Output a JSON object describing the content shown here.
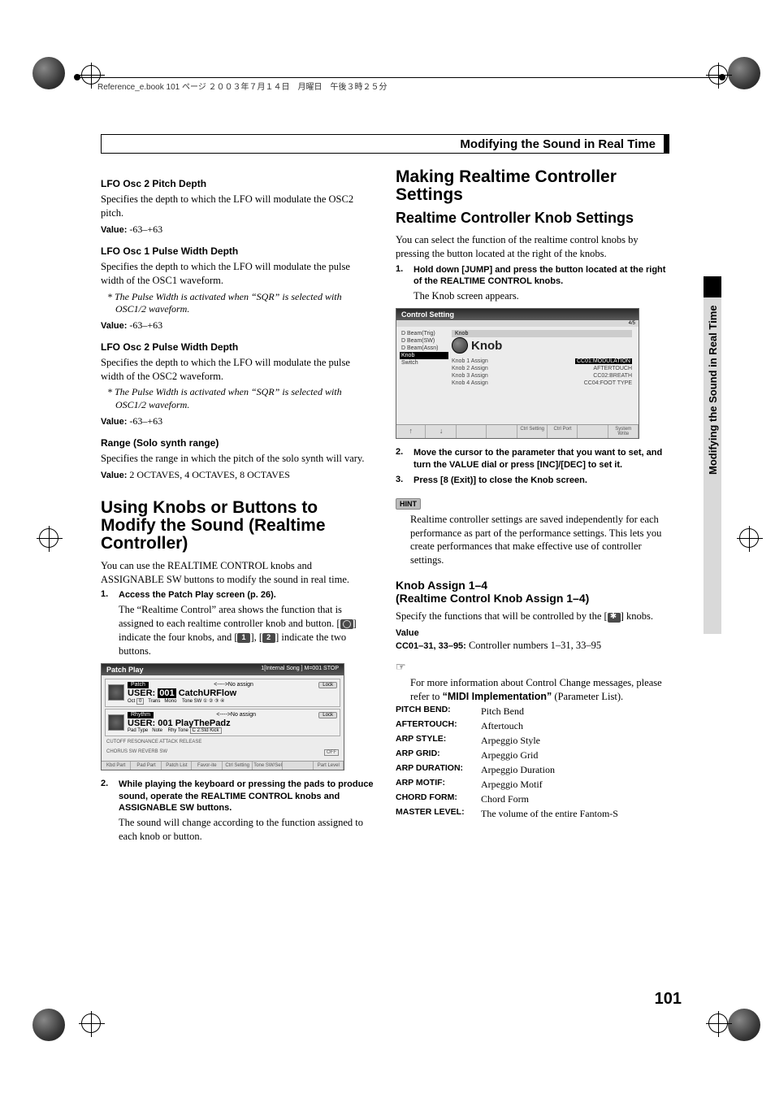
{
  "header_text": "Reference_e.book 101 ページ ２００３年７月１４日　月曜日　午後３時２５分",
  "section_bar_title": "Modifying the Sound in Real Time",
  "side_tab_label": "Modifying the Sound in Real Time",
  "page_number": "101",
  "left": {
    "h1": {
      "title": "LFO Osc 2 Pitch Depth",
      "body": "Specifies the depth to which the LFO will modulate the OSC2 pitch.",
      "value_label": "Value:",
      "value": "-63–+63"
    },
    "h2": {
      "title": "LFO Osc 1 Pulse Width Depth",
      "body": "Specifies the depth to which the LFO will modulate the pulse width of the OSC1 waveform.",
      "note": "* The Pulse Width is activated when “SQR” is selected with OSC1/2 waveform.",
      "value_label": "Value:",
      "value": "-63–+63"
    },
    "h3": {
      "title": "LFO Osc 2 Pulse Width Depth",
      "body": "Specifies the depth to which the LFO will modulate the pulse width of the OSC2 waveform.",
      "note": "* The Pulse Width is activated when “SQR” is selected with OSC1/2 waveform.",
      "value_label": "Value:",
      "value": "-63–+63"
    },
    "h4": {
      "title": "Range (Solo synth range)",
      "body": "Specifies the range in which the pitch of the solo synth will vary.",
      "value_label": "Value:",
      "value": "2 OCTAVES, 4 OCTAVES, 8 OCTAVES"
    },
    "knobs_head": "Using Knobs or Buttons to Modify the Sound (Realtime Controller)",
    "knobs_intro": "You can use the REALTIME CONTROL knobs and ASSIGNABLE SW buttons to modify the sound in real time.",
    "step1": {
      "num": "1.",
      "bold": "Access the Patch Play screen (p. 26).",
      "sub_a": "The “Realtime Control” area shows the function that is assigned to each realtime controller knob and button. [",
      "sub_b": "] indicate the four knobs, and [",
      "sub_c": "], [",
      "sub_d": "] indicate the two buttons."
    },
    "screen": {
      "title": "Patch Play",
      "top_right": "1[Internal Song ]   M=001   STOP",
      "patch_label": "Patch",
      "no_assign": "<---->No assign",
      "lock": "Lock",
      "user_label": "USER:",
      "patch_num": "001",
      "patch_name": "CatchURFlow",
      "oct": "Oct",
      "oct_val": "0",
      "trans": "Trans",
      "mono": "Mono",
      "tone_sw": "Tone SW",
      "rhy_label": "Rhythm",
      "rhy_user": "USER:",
      "rhy_num": "001",
      "rhy_name": "PlayThePadz",
      "pad_type": "Pad Type",
      "pad_note": "Note",
      "rhy_tone": "Rhy Tone",
      "rhy_tone_val": "C 2:Std Kick",
      "knob_row": "CUTOFF    RESONANCE   ATTACK        RELEASE",
      "sw_row": "CHORUS SW   REVERB SW",
      "off": "OFF",
      "tabs": [
        "Kbd Part",
        "Pad Part",
        "Patch List",
        "Favor-ite",
        "Ctrl Setting",
        "Tone SW/Sel",
        "",
        "Part Level"
      ]
    },
    "step2": {
      "num": "2.",
      "bold": "While playing the keyboard or pressing the pads to produce sound, operate the REALTIME CONTROL knobs and ASSIGNABLE SW buttons.",
      "sub": "The sound will change according to the function assigned to each knob or button."
    }
  },
  "right": {
    "head1": "Making Realtime Controller Settings",
    "head2": "Realtime Controller Knob Settings",
    "intro": "You can select the function of the realtime control knobs by pressing the button located at the right of the knobs.",
    "step1": {
      "num": "1.",
      "bold": "Hold down [JUMP] and press the button located at the right of the REALTIME CONTROL knobs.",
      "sub": "The Knob screen appears."
    },
    "screen": {
      "title": "Control Setting",
      "crumbs": "4/5",
      "side_items": [
        "D Beam(Trig)",
        "D Beam(SW)",
        "D Beam(Assn)",
        "Knob",
        "Switch"
      ],
      "side_selected_index": 3,
      "main_label": "Knob",
      "assigns": [
        {
          "l": "Knob 1 Assign",
          "r": "CC01:MODULATION",
          "sel": true
        },
        {
          "l": "Knob 2 Assign",
          "r": "AFTERTOUCH",
          "sel": false
        },
        {
          "l": "Knob 3 Assign",
          "r": "CC02:BREATH",
          "sel": false
        },
        {
          "l": "Knob 4 Assign",
          "r": "CC04:FOOT TYPE",
          "sel": false
        }
      ],
      "btab": [
        "↑",
        "↓",
        "",
        "",
        "Ctrl Setting",
        "Ctrl Port",
        "",
        "System Write"
      ]
    },
    "step2": {
      "num": "2.",
      "bold": "Move the cursor to the parameter that you want to set, and turn the VALUE dial or press [INC]/[DEC] to set it."
    },
    "step3": {
      "num": "3.",
      "bold": "Press [8 (Exit)] to close the Knob screen."
    },
    "hint_label": "HINT",
    "hint_body": "Realtime controller settings are saved independently for each performance as part of the performance settings. This lets you create performances that make effective use of controller settings.",
    "knob_assign_head": "Knob Assign 1–4\n(Realtime Control Knob Assign 1–4)",
    "knob_assign_body_a": "Specify the functions that will be controlled by the [",
    "knob_assign_body_b": "] knobs.",
    "value_label": "Value",
    "cc_label": "CC01–31, 33–95:",
    "cc_body": "Controller numbers 1–31, 33–95",
    "memo_icon": "☞",
    "memo_body_a": "For more information about Control Change messages, please refer to ",
    "memo_bold": "“MIDI Implementation”",
    "memo_body_b": " (Parameter List).",
    "params": [
      {
        "k": "PITCH BEND:",
        "v": "Pitch Bend"
      },
      {
        "k": "AFTERTOUCH:",
        "v": "Aftertouch"
      },
      {
        "k": "ARP STYLE:",
        "v": "Arpeggio Style"
      },
      {
        "k": "ARP GRID:",
        "v": "Arpeggio Grid"
      },
      {
        "k": "ARP DURATION:",
        "v": "Arpeggio Duration"
      },
      {
        "k": "ARP MOTIF:",
        "v": "Arpeggio Motif"
      },
      {
        "k": "CHORD FORM:",
        "v": "Chord Form"
      },
      {
        "k": "MASTER LEVEL:",
        "v": "The volume of the entire Fantom-S"
      }
    ]
  }
}
